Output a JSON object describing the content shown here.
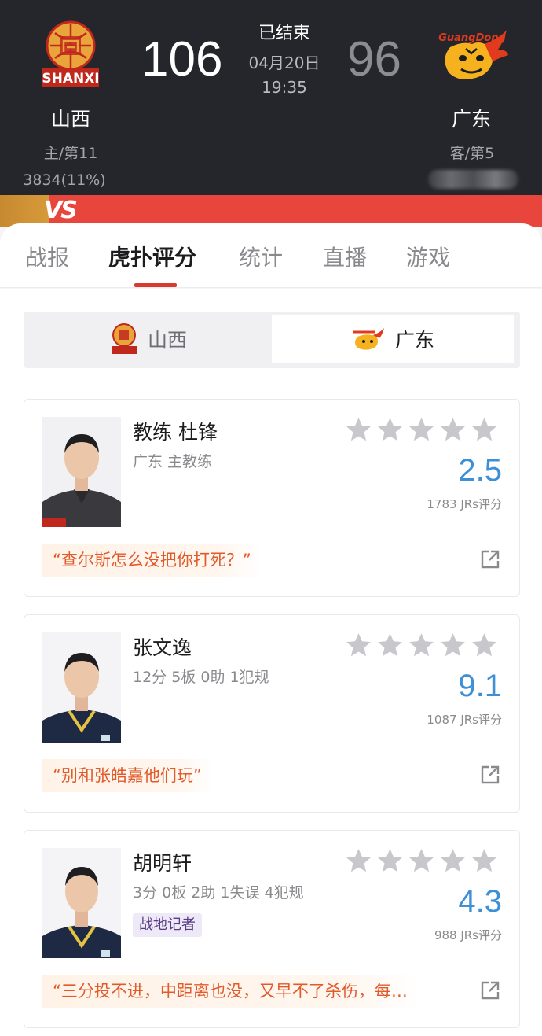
{
  "header": {
    "home": {
      "name": "山西",
      "rank": "主/第11",
      "support": "3834(11%)",
      "score": "106",
      "logo_text": "SHANXI"
    },
    "away": {
      "name": "广东",
      "rank": "客/第5",
      "score": "96",
      "logo_text": "GuangDong"
    },
    "status": "已结束",
    "date": "04月20日",
    "time": "19:35",
    "vs_label": "VS"
  },
  "tabs": [
    {
      "label": "战报",
      "active": false
    },
    {
      "label": "虎扑评分",
      "active": true
    },
    {
      "label": "统计",
      "active": false
    },
    {
      "label": "直播",
      "active": false
    },
    {
      "label": "游戏",
      "active": false
    }
  ],
  "switcher": {
    "left": "山西",
    "right": "广东",
    "selected": "广东"
  },
  "cards": [
    {
      "name": "教练 杜锋",
      "stat": "广东 主教练",
      "rating": "2.5",
      "votes": "1783 JRs评分",
      "quote": "“查尔斯怎么没把你打死？”",
      "tag": ""
    },
    {
      "name": "张文逸",
      "stat": "12分 5板 0助 1犯规",
      "rating": "9.1",
      "votes": "1087 JRs评分",
      "quote": "“别和张皓嘉他们玩”",
      "tag": ""
    },
    {
      "name": "胡明轩",
      "stat": "3分 0板 2助 1失误 4犯规",
      "rating": "4.3",
      "votes": "988 JRs评分",
      "quote": "“三分投不进，中距离也没，又早不了杀伤，每…",
      "tag": "战地记者"
    }
  ],
  "colors": {
    "accent": "#d83a2f",
    "rating": "#3d8fd8",
    "quote": "#e15a2a",
    "header_bg": "#25262b"
  }
}
